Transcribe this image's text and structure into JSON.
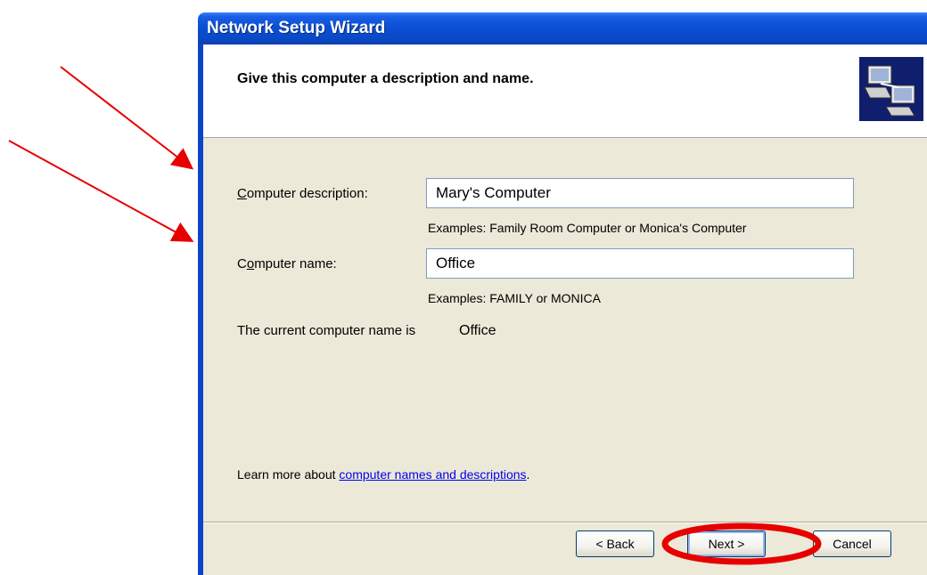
{
  "window": {
    "title": "Network Setup Wizard"
  },
  "header": {
    "heading": "Give this computer a description and name.",
    "logo_icon": "network-computers-icon"
  },
  "form": {
    "description_label": "Computer description:",
    "description_value": "Mary's Computer",
    "description_example": "Examples: Family Room Computer or Monica's Computer",
    "name_label": "Computer name:",
    "name_value": "Office",
    "name_example": "Examples: FAMILY or MONICA",
    "current_name_label": "The current computer name is",
    "current_name_value": "Office"
  },
  "learn_more": {
    "prefix": "Learn more about ",
    "link_text": "computer names and descriptions",
    "suffix": "."
  },
  "buttons": {
    "back": "< Back",
    "next": "Next >",
    "cancel": "Cancel"
  },
  "colors": {
    "titlebar": "#0b4fd4",
    "client": "#ece9d8",
    "annotation": "#e60000",
    "link": "#0000ee"
  }
}
